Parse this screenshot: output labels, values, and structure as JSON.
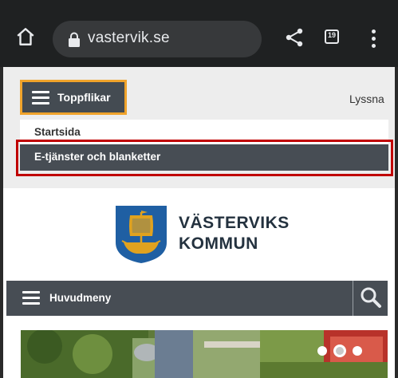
{
  "browser": {
    "url": "vastervik.se",
    "tab_count": "19"
  },
  "topbar": {
    "toppflikar_label": "Toppflikar",
    "lyssna_label": "Lyssna"
  },
  "subnav": {
    "items": [
      {
        "label": "Startsida"
      },
      {
        "label": "E-tjänster och blanketter"
      }
    ]
  },
  "logo": {
    "line1": "VÄSTERVIKS",
    "line2": "KOMMUN"
  },
  "mainnav": {
    "label": "Huvudmeny"
  },
  "colors": {
    "chrome_bg": "#1f2122",
    "nav_dark": "#474d54",
    "accent_orange": "#f0a32b",
    "highlight_red": "#c00000",
    "logo_text": "#24323f",
    "emblem_blue": "#1f5fa3",
    "emblem_gold": "#e0a21f"
  },
  "icons": [
    "home-icon",
    "lock-icon",
    "share-icon",
    "tab-switcher-icon",
    "more-vert-icon",
    "hamburger-icon",
    "search-icon"
  ]
}
